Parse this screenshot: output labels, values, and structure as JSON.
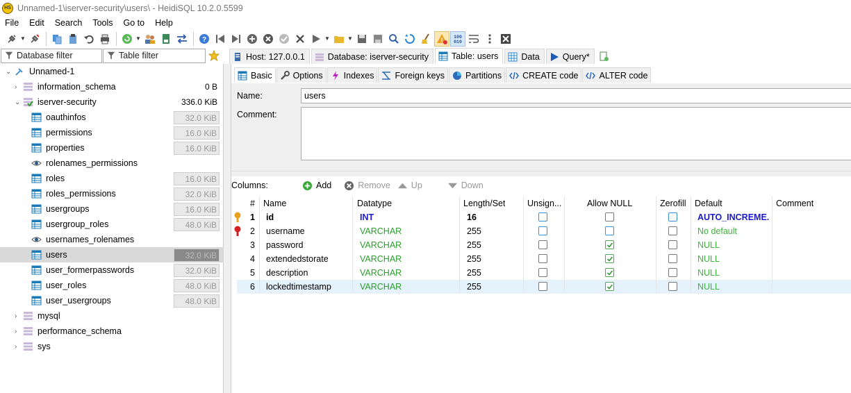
{
  "window": {
    "title": "Unnamed-1\\iserver-security\\users\\ - HeidiSQL 10.2.0.5599",
    "app_icon_text": "HS"
  },
  "menu": [
    "File",
    "Edit",
    "Search",
    "Tools",
    "Go to",
    "Help"
  ],
  "filters": {
    "database_filter": "Database filter",
    "table_filter": "Table filter"
  },
  "top_tabs": [
    {
      "label": "Host: 127.0.0.1",
      "icon": "host-icon"
    },
    {
      "label": "Database: iserver-security",
      "icon": "database-icon"
    },
    {
      "label": "Table: users",
      "icon": "table-icon",
      "active": true
    },
    {
      "label": "Data",
      "icon": "data-grid-icon"
    },
    {
      "label": "Query*",
      "icon": "query-play-icon"
    }
  ],
  "tree": {
    "root": "Unnamed-1",
    "databases": [
      {
        "name": "information_schema",
        "size": "0 B"
      },
      {
        "name": "iserver-security",
        "size": "336.0 KiB"
      }
    ],
    "tables": [
      {
        "name": "oauthinfos",
        "size": "32.0 KiB",
        "icon": "table"
      },
      {
        "name": "permissions",
        "size": "16.0 KiB",
        "icon": "table"
      },
      {
        "name": "properties",
        "size": "16.0 KiB",
        "icon": "table"
      },
      {
        "name": "rolenames_permissions",
        "size": "",
        "icon": "view"
      },
      {
        "name": "roles",
        "size": "16.0 KiB",
        "icon": "table"
      },
      {
        "name": "roles_permissions",
        "size": "32.0 KiB",
        "icon": "table"
      },
      {
        "name": "usergroups",
        "size": "16.0 KiB",
        "icon": "table"
      },
      {
        "name": "usergroup_roles",
        "size": "48.0 KiB",
        "icon": "table"
      },
      {
        "name": "usernames_rolenames",
        "size": "",
        "icon": "view"
      },
      {
        "name": "users",
        "size": "32.0 KiB",
        "icon": "table",
        "selected": true
      },
      {
        "name": "user_formerpasswords",
        "size": "32.0 KiB",
        "icon": "table"
      },
      {
        "name": "user_roles",
        "size": "48.0 KiB",
        "icon": "table"
      },
      {
        "name": "user_usergroups",
        "size": "48.0 KiB",
        "icon": "table"
      }
    ],
    "other_databases": [
      "mysql",
      "performance_schema",
      "sys"
    ]
  },
  "sub_tabs": [
    "Basic",
    "Options",
    "Indexes",
    "Foreign keys",
    "Partitions",
    "CREATE code",
    "ALTER code"
  ],
  "form": {
    "name_label": "Name:",
    "name_value": "users",
    "comment_label": "Comment:",
    "comment_value": ""
  },
  "columns_bar": {
    "label": "Columns:",
    "add": "Add",
    "remove": "Remove",
    "up": "Up",
    "down": "Down"
  },
  "grid": {
    "headers": [
      "#",
      "Name",
      "Datatype",
      "Length/Set",
      "Unsign...",
      "Allow NULL",
      "Zerofill",
      "Default",
      "Comment"
    ],
    "rows": [
      {
        "num": "1",
        "name": "id",
        "type": "INT",
        "length": "16",
        "unsigned": false,
        "allow_null": false,
        "zerofill": false,
        "default": "AUTO_INCREME...",
        "comment": "",
        "key": "primary"
      },
      {
        "num": "2",
        "name": "username",
        "type": "VARCHAR",
        "length": "255",
        "unsigned": false,
        "allow_null": false,
        "zerofill": false,
        "default": "No default",
        "comment": "",
        "key": "unique"
      },
      {
        "num": "3",
        "name": "password",
        "type": "VARCHAR",
        "length": "255",
        "unsigned": false,
        "allow_null": true,
        "zerofill": false,
        "default": "NULL",
        "comment": ""
      },
      {
        "num": "4",
        "name": "extendedstorate",
        "type": "VARCHAR",
        "length": "255",
        "unsigned": false,
        "allow_null": true,
        "zerofill": false,
        "default": "NULL",
        "comment": ""
      },
      {
        "num": "5",
        "name": "description",
        "type": "VARCHAR",
        "length": "255",
        "unsigned": false,
        "allow_null": true,
        "zerofill": false,
        "default": "NULL",
        "comment": ""
      },
      {
        "num": "6",
        "name": "lockedtimestamp",
        "type": "VARCHAR",
        "length": "255",
        "unsigned": false,
        "allow_null": true,
        "zerofill": false,
        "default": "NULL",
        "comment": "",
        "selected": true
      }
    ]
  },
  "colors": {
    "type_green": "#2a9d2a",
    "default_blue": "#1a1acc",
    "default_green": "#3fb23f",
    "selection": "#e5f1fb"
  }
}
